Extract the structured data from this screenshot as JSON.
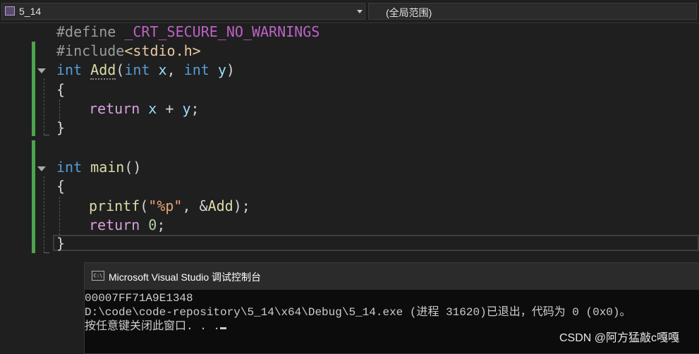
{
  "navbar": {
    "project": "5_14",
    "scope": "(全局范围)"
  },
  "code": {
    "l1": {
      "define_kw": "#define ",
      "macro": "_CRT_SECURE_NO_WARNINGS"
    },
    "l2": {
      "include_kw": "#include",
      "header": "<stdio.h>"
    },
    "l3": {
      "t1": "int",
      "fname": "Add",
      "p1": "(",
      "t2": "int",
      "x": " x",
      "comma": ", ",
      "t3": "int",
      "y": " y",
      "p2": ")"
    },
    "l4": "{",
    "l5": {
      "ret": "return",
      "expr_x": " x",
      "plus": " + ",
      "expr_y": "y",
      "semi": ";"
    },
    "l6": "}",
    "l8": {
      "t": "int",
      "fname": "main",
      "parens": "()"
    },
    "l9": "{",
    "l10": {
      "fn": "printf",
      "open": "(",
      "fmt": "\"%p\"",
      "comma": ", &",
      "arg": "Add",
      "close": ");"
    },
    "l11": {
      "ret": "return",
      "num": " 0",
      "semi": ";"
    },
    "l12": "}"
  },
  "console": {
    "title": "Microsoft Visual Studio 调试控制台",
    "icon_text": "C:\\",
    "lines": [
      "00007FF71A9E1348",
      "D:\\code\\code-repository\\5_14\\x64\\Debug\\5_14.exe (进程 31620)已退出，代码为 0 (0x0)。",
      "按任意键关闭此窗口. . ."
    ]
  },
  "watermark": "CSDN @阿方猛敲c嘎嘎",
  "colors": {
    "background": "#1f1f1f",
    "keyword": "#569cd6",
    "function": "#dcdcaa",
    "macro": "#bd63c5",
    "string": "#e8a479",
    "change_bar": "#4ea34e"
  }
}
